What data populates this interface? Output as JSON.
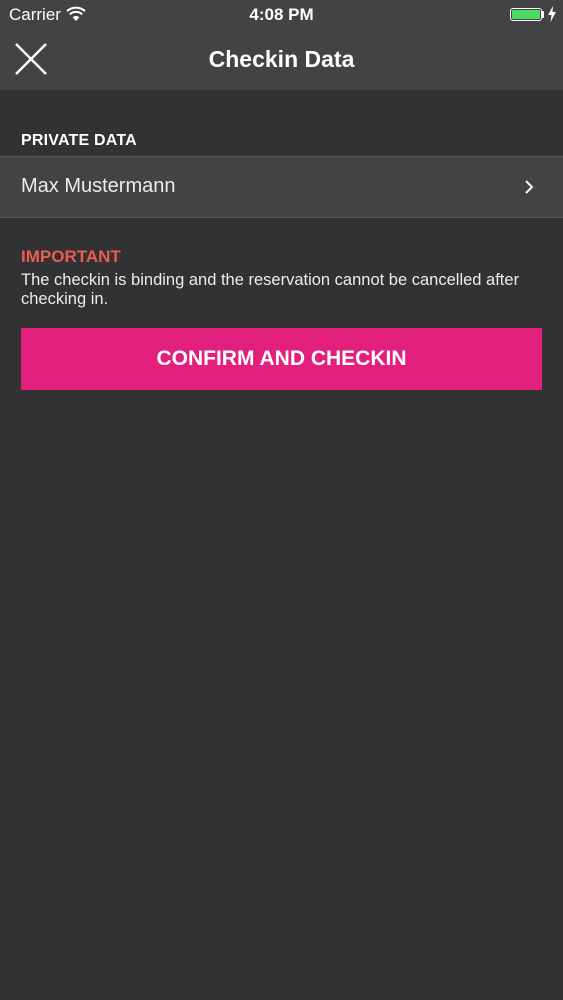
{
  "status_bar": {
    "carrier": "Carrier",
    "time": "4:08 PM",
    "battery_color": "#4cd964"
  },
  "nav": {
    "title": "Checkin Data",
    "close_icon": "close-icon"
  },
  "private_data": {
    "header": "PRIVATE DATA",
    "name": "Max Mustermann",
    "chevron_icon": "chevron-right-icon"
  },
  "important": {
    "title": "IMPORTANT",
    "text": "The checkin is binding and the reservation cannot be cancelled after checking in.",
    "color": "#ea5b54"
  },
  "confirm_button": {
    "label": "CONFIRM AND CHECKIN",
    "color": "#e21f7c"
  },
  "colors": {
    "background": "#323133",
    "bar": "#434244"
  }
}
